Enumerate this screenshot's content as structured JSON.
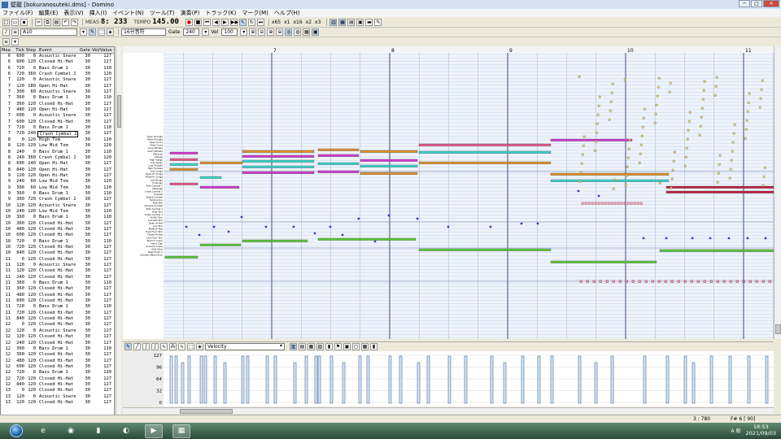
{
  "window": {
    "title": "壁龍 [bokuranosuteki.dms] - Domino"
  },
  "window_buttons": [
    "─",
    "□",
    "✕"
  ],
  "menu": [
    "ファイル(F)",
    "編集(E)",
    "表示(V)",
    "挿入(I)",
    "イベント(N)",
    "ツール(T)",
    "演奏(P)",
    "トラック(K)",
    "マーク(M)",
    "ヘルプ(H)"
  ],
  "toolbar1": {
    "meas_label": "MEAS",
    "position": "8: 233",
    "tempo_label": "TEMPO",
    "tempo": "145.00",
    "zoom_buttons": [
      "x65",
      "x1",
      "x16",
      "x2",
      "x3"
    ]
  },
  "toolbar2": {
    "track": "A10",
    "note_length": "16分音符",
    "gate_label": "Gate",
    "gate_value": "240",
    "vel_label": "Vel",
    "vel_value": "100"
  },
  "event_list": {
    "columns": [
      "Mea",
      "Tick",
      "Step",
      "Event",
      "Gate",
      "Vel/Value"
    ],
    "selected_row": 13,
    "rows": [
      [
        "6",
        "600",
        "0",
        "Acoustic Snare",
        "30",
        "127"
      ],
      [
        "6",
        "600",
        "120",
        "Closed Hi-Hat",
        "30",
        "127"
      ],
      [
        "6",
        "720",
        "0",
        "Bass Drum 1",
        "30",
        "110"
      ],
      [
        "6",
        "720",
        "360",
        "Crash Cymbal 1",
        "30",
        "120"
      ],
      [
        "7",
        "120",
        "0",
        "Acoustic Snare",
        "30",
        "127"
      ],
      [
        "7",
        "120",
        "180",
        "Open Hi-Hat",
        "30",
        "127"
      ],
      [
        "7",
        "300",
        "60",
        "Acoustic Snare",
        "30",
        "127"
      ],
      [
        "7",
        "360",
        "0",
        "Bass Drum 1",
        "30",
        "110"
      ],
      [
        "7",
        "360",
        "120",
        "Closed Hi-Hat",
        "30",
        "127"
      ],
      [
        "7",
        "480",
        "120",
        "Open Hi-Hat",
        "30",
        "127"
      ],
      [
        "7",
        "600",
        "0",
        "Acoustic Snare",
        "30",
        "127"
      ],
      [
        "7",
        "600",
        "120",
        "Closed Hi-Hat",
        "30",
        "127"
      ],
      [
        "7",
        "720",
        "0",
        "Bass Drum 1",
        "30",
        "110"
      ],
      [
        "7",
        "720",
        "240",
        "Crash Cymbal 2",
        "30",
        "127"
      ],
      [
        "8",
        "0",
        "120",
        "High Tom",
        "30",
        "120"
      ],
      [
        "8",
        "120",
        "120",
        "Low Mid Tom",
        "30",
        "120"
      ],
      [
        "8",
        "240",
        "0",
        "Bass Drum 1",
        "30",
        "110"
      ],
      [
        "8",
        "240",
        "360",
        "Crash Cymbal 1",
        "30",
        "120"
      ],
      [
        "8",
        "600",
        "240",
        "Open Hi-Hat",
        "30",
        "127"
      ],
      [
        "8",
        "840",
        "120",
        "Open Hi-Hat",
        "30",
        "127"
      ],
      [
        "9",
        "120",
        "120",
        "Open Hi-Hat",
        "30",
        "127"
      ],
      [
        "9",
        "240",
        "60",
        "Low Mid Tom",
        "30",
        "120"
      ],
      [
        "9",
        "300",
        "60",
        "Low Mid Tom",
        "30",
        "120"
      ],
      [
        "9",
        "360",
        "0",
        "Bass Drum 1",
        "30",
        "110"
      ],
      [
        "9",
        "360",
        "720",
        "Crash Cymbal 2",
        "30",
        "127"
      ],
      [
        "10",
        "120",
        "120",
        "Acoustic Snare",
        "30",
        "127"
      ],
      [
        "10",
        "240",
        "120",
        "Low Mid Tom",
        "30",
        "120"
      ],
      [
        "10",
        "360",
        "0",
        "Bass Drum 1",
        "30",
        "110"
      ],
      [
        "10",
        "360",
        "120",
        "Closed Hi-Hat",
        "30",
        "127"
      ],
      [
        "10",
        "480",
        "120",
        "Closed Hi-Hat",
        "30",
        "127"
      ],
      [
        "10",
        "600",
        "120",
        "Closed Hi-Hat",
        "30",
        "127"
      ],
      [
        "10",
        "720",
        "0",
        "Bass Drum 1",
        "30",
        "110"
      ],
      [
        "10",
        "720",
        "120",
        "Closed Hi-Hat",
        "30",
        "127"
      ],
      [
        "10",
        "840",
        "120",
        "Closed Hi-Hat",
        "30",
        "127"
      ],
      [
        "11",
        "0",
        "120",
        "Closed Hi-Hat",
        "30",
        "127"
      ],
      [
        "11",
        "120",
        "0",
        "Acoustic Snare",
        "30",
        "127"
      ],
      [
        "11",
        "120",
        "120",
        "Closed Hi-Hat",
        "30",
        "127"
      ],
      [
        "11",
        "240",
        "120",
        "Closed Hi-Hat",
        "30",
        "127"
      ],
      [
        "11",
        "360",
        "0",
        "Bass Drum 1",
        "30",
        "110"
      ],
      [
        "11",
        "360",
        "120",
        "Closed Hi-Hat",
        "30",
        "127"
      ],
      [
        "11",
        "480",
        "120",
        "Closed Hi-Hat",
        "30",
        "127"
      ],
      [
        "11",
        "600",
        "120",
        "Closed Hi-Hat",
        "30",
        "127"
      ],
      [
        "11",
        "720",
        "0",
        "Bass Drum 1",
        "30",
        "110"
      ],
      [
        "11",
        "720",
        "120",
        "Closed Hi-Hat",
        "30",
        "127"
      ],
      [
        "11",
        "840",
        "120",
        "Closed Hi-Hat",
        "30",
        "127"
      ],
      [
        "12",
        "0",
        "120",
        "Closed Hi-Hat",
        "30",
        "127"
      ],
      [
        "12",
        "120",
        "0",
        "Acoustic Snare",
        "30",
        "127"
      ],
      [
        "12",
        "120",
        "120",
        "Closed Hi-Hat",
        "30",
        "127"
      ],
      [
        "12",
        "240",
        "120",
        "Closed Hi-Hat",
        "30",
        "127"
      ],
      [
        "12",
        "360",
        "0",
        "Bass Drum 1",
        "30",
        "110"
      ],
      [
        "12",
        "360",
        "120",
        "Closed Hi-Hat",
        "30",
        "127"
      ],
      [
        "12",
        "480",
        "120",
        "Closed Hi-Hat",
        "30",
        "127"
      ],
      [
        "12",
        "600",
        "120",
        "Closed Hi-Hat",
        "30",
        "127"
      ],
      [
        "12",
        "720",
        "0",
        "Bass Drum 1",
        "30",
        "110"
      ],
      [
        "12",
        "720",
        "120",
        "Closed Hi-Hat",
        "30",
        "127"
      ],
      [
        "12",
        "840",
        "120",
        "Closed Hi-Hat",
        "30",
        "127"
      ],
      [
        "13",
        "0",
        "120",
        "Closed Hi-Hat",
        "30",
        "127"
      ],
      [
        "13",
        "120",
        "0",
        "Acoustic Snare",
        "30",
        "127"
      ],
      [
        "13",
        "120",
        "120",
        "Closed Hi-Hat",
        "30",
        "127"
      ]
    ]
  },
  "piano_roll": {
    "measure_numbers": [
      7,
      8,
      9,
      10,
      11
    ],
    "drum_names": [
      "Open Triangle",
      "Mute Triangle",
      "Open Cuica",
      "Mute Cuica",
      "Long Whistle",
      "Short Whistle",
      "Maracas",
      "Cabasa",
      "High Agogo",
      "Low Agogo",
      "Low Timbale",
      "High Timbale",
      "Low Conga",
      "Open Hi Conga",
      "Mute Hi Conga",
      "Low Bongo",
      "Hi Bongo",
      "Ride Cymbal 2",
      "Vibraslap",
      "Crash Cymbal 2",
      "Cowbell",
      "Splash Cymbal",
      "Tambourine",
      "Ride Bell",
      "Chinese Cymbal",
      "Ride Cymbal 1",
      "High Tom",
      "Crash Cymbal 1",
      "Hi-Mid Tom",
      "Low-Mid Tom",
      "Open Hi-Hat",
      "Low Tom",
      "Pedal Hi-Hat",
      "High Floor Tom",
      "Closed Hi-Hat",
      "Low Floor Tom",
      "Electric Snare",
      "Hand Clap",
      "Acoustic Snare",
      "Side Stick",
      "Bass Drum 1",
      "Acoustic Bass Drum"
    ],
    "colors": {
      "grid_bg": "#eef3fb",
      "grid_line": "#c9d6e8",
      "beat_line": "#9fb6d6",
      "measure_line": "#3a4d7a",
      "orange": "#e0902a",
      "magenta": "#d23ad2",
      "cyan": "#3ad2c8",
      "pink": "#e8568a",
      "green": "#5cc83a",
      "crimson": "#c02040",
      "blue_dot": "#3a3ac8",
      "yellow_box": "#e8d25a"
    }
  },
  "velocity_panel": {
    "controller": "Velocity",
    "scale": [
      "127",
      "96",
      "64",
      "32",
      "0"
    ]
  },
  "status": {
    "position": "3 : 780",
    "note": "F# 6 [ 90]"
  },
  "taskbar": {
    "time": "18:53",
    "date": "2021/09/03",
    "tray_text": "A 般",
    "icons": [
      "e",
      "◉",
      "▮",
      "◐",
      "▶",
      "▦"
    ]
  }
}
